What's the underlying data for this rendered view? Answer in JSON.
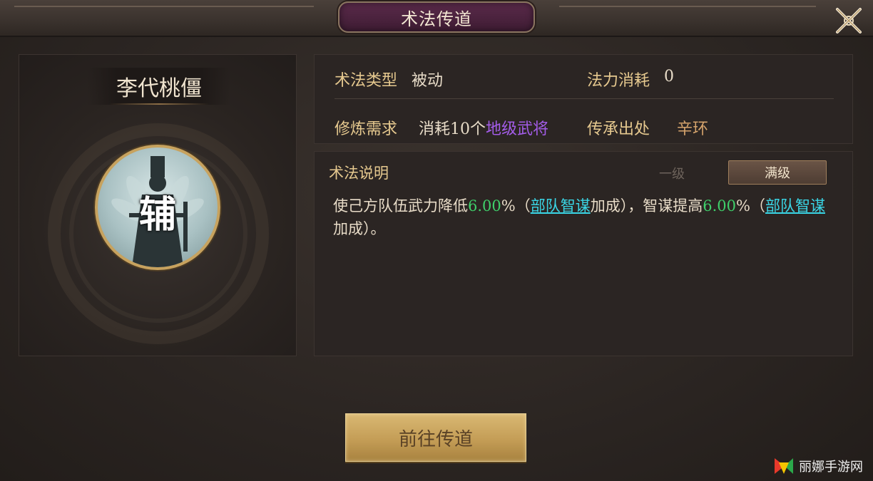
{
  "header": {
    "title": "术法传道"
  },
  "skill": {
    "name": "李代桃僵",
    "portrait_char": "辅"
  },
  "info": {
    "type_label": "术法类型",
    "type_value": "被动",
    "cost_label": "法力消耗",
    "cost_value": "0",
    "require_label": "修炼需求",
    "require_prefix": "消耗10个",
    "require_highlight": "地级武将",
    "origin_label": "传承出处",
    "origin_value": "辛环"
  },
  "description": {
    "title": "术法说明",
    "level_one": "一级",
    "level_max": "满级",
    "t1": "使己方队伍武力降低",
    "v1": "6.00",
    "t2": "%（",
    "link1": "部队智谋",
    "t3": "加成），智谋提高",
    "v2": "6.00",
    "t4": "%（",
    "link2": "部队智谋",
    "t5": "加成）。"
  },
  "actions": {
    "goto": "前往传道"
  },
  "watermark": {
    "text": "丽娜手游网"
  },
  "colors": {
    "title_plate": "#5a2a4a",
    "label_gold": "#e6c98f",
    "value_purple": "#a35ce8",
    "value_green": "#3fcf6a",
    "link_cyan": "#3ad6e6",
    "button_gold": "#c49d56"
  }
}
